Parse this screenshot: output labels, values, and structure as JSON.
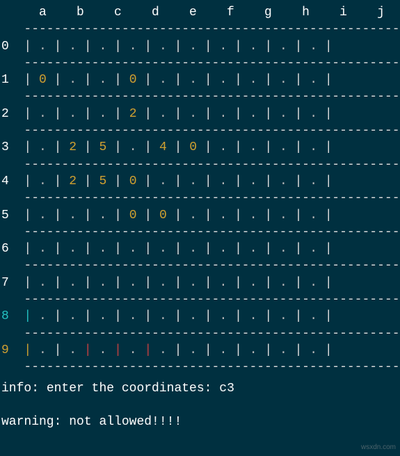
{
  "grid": {
    "columns": [
      "a",
      "b",
      "c",
      "d",
      "e",
      "f",
      "g",
      "h",
      "i",
      "j"
    ],
    "rows": [
      "0",
      "1",
      "2",
      "3",
      "4",
      "5",
      "6",
      "7",
      "8",
      "9"
    ],
    "cells": [
      [
        ".",
        ".",
        ".",
        ".",
        ".",
        ".",
        ".",
        ".",
        ".",
        "."
      ],
      [
        "0",
        ".",
        ".",
        "0",
        ".",
        ".",
        ".",
        ".",
        ".",
        "."
      ],
      [
        ".",
        ".",
        ".",
        "2",
        ".",
        ".",
        ".",
        ".",
        ".",
        "."
      ],
      [
        ".",
        "2",
        "5",
        ".",
        "4",
        "0",
        ".",
        ".",
        ".",
        "."
      ],
      [
        ".",
        "2",
        "5",
        "0",
        ".",
        ".",
        ".",
        ".",
        ".",
        "."
      ],
      [
        ".",
        ".",
        ".",
        "0",
        "0",
        ".",
        ".",
        ".",
        ".",
        "."
      ],
      [
        ".",
        ".",
        ".",
        ".",
        ".",
        ".",
        ".",
        ".",
        ".",
        "."
      ],
      [
        ".",
        ".",
        ".",
        ".",
        ".",
        ".",
        ".",
        ".",
        ".",
        "."
      ],
      [
        ".",
        ".",
        ".",
        ".",
        ".",
        ".",
        ".",
        ".",
        ".",
        "."
      ],
      [
        ".",
        ".",
        ".",
        ".",
        ".",
        ".",
        ".",
        ".",
        ".",
        "."
      ]
    ]
  },
  "styles": {
    "row_label": {
      "8": "row8l",
      "9": "row9l"
    },
    "first_pipe": {
      "8": "row8p",
      "9": "row9p"
    },
    "cell_pipe_override": {
      "9": {
        "b": "redp",
        "c": "redp",
        "d": "redp"
      }
    }
  },
  "messages": {
    "info_label": "info:",
    "info_text": "enter the coordinates:",
    "input_value": "c3",
    "warning_label": "warning:",
    "warning_text": "not allowed!!!!"
  },
  "watermark": "wsxdn.com"
}
